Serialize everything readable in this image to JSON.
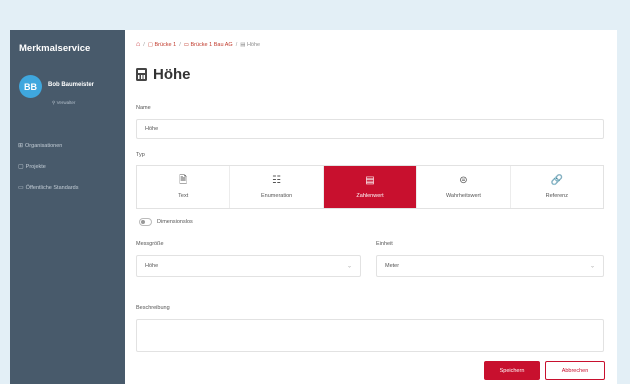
{
  "sidebar": {
    "title": "Merkmalservice",
    "user": {
      "initials": "BB",
      "name": "Bob Baumeister",
      "role": "Verwalter"
    },
    "items": [
      {
        "label": "Organisationen",
        "icon": "organization-icon"
      },
      {
        "label": "Projekte",
        "icon": "folder-icon"
      },
      {
        "label": "Öffentliche Standards",
        "icon": "calendar-icon"
      }
    ]
  },
  "breadcrumb": {
    "items": [
      {
        "label": "Brücke 1",
        "icon": "folder-icon"
      },
      {
        "label": "Brücke 1 Bau AG",
        "icon": "calendar-icon"
      },
      {
        "label": "Höhe",
        "icon": "number-icon"
      }
    ]
  },
  "page": {
    "title": "Höhe",
    "icon": "number-icon"
  },
  "form": {
    "name_label": "Name",
    "name_value": "Höhe",
    "type_label": "Typ",
    "types": [
      {
        "label": "Text",
        "icon": "text-icon",
        "glyph": "🗎",
        "active": false
      },
      {
        "label": "Enumeration",
        "icon": "list-icon",
        "glyph": "☷",
        "active": false
      },
      {
        "label": "Zahlenwert",
        "icon": "number-icon",
        "glyph": "▤",
        "active": true
      },
      {
        "label": "Wahrheitswert",
        "icon": "toggle-icon",
        "glyph": "⊜",
        "active": false
      },
      {
        "label": "Referenz",
        "icon": "link-icon",
        "glyph": "🔗",
        "active": false
      }
    ],
    "dimensionless_label": "Dimensionslos",
    "quantity_label": "Messgröße",
    "quantity_value": "Höhe",
    "unit_label": "Einheit",
    "unit_value": "Meter",
    "description_label": "Beschreibung",
    "description_value": "",
    "save_label": "Speichern",
    "cancel_label": "Abbrechen"
  },
  "colors": {
    "accent": "#c8102e",
    "sidebar": "#485a6b",
    "background": "#e3eff6",
    "avatar": "#3fa7de"
  }
}
